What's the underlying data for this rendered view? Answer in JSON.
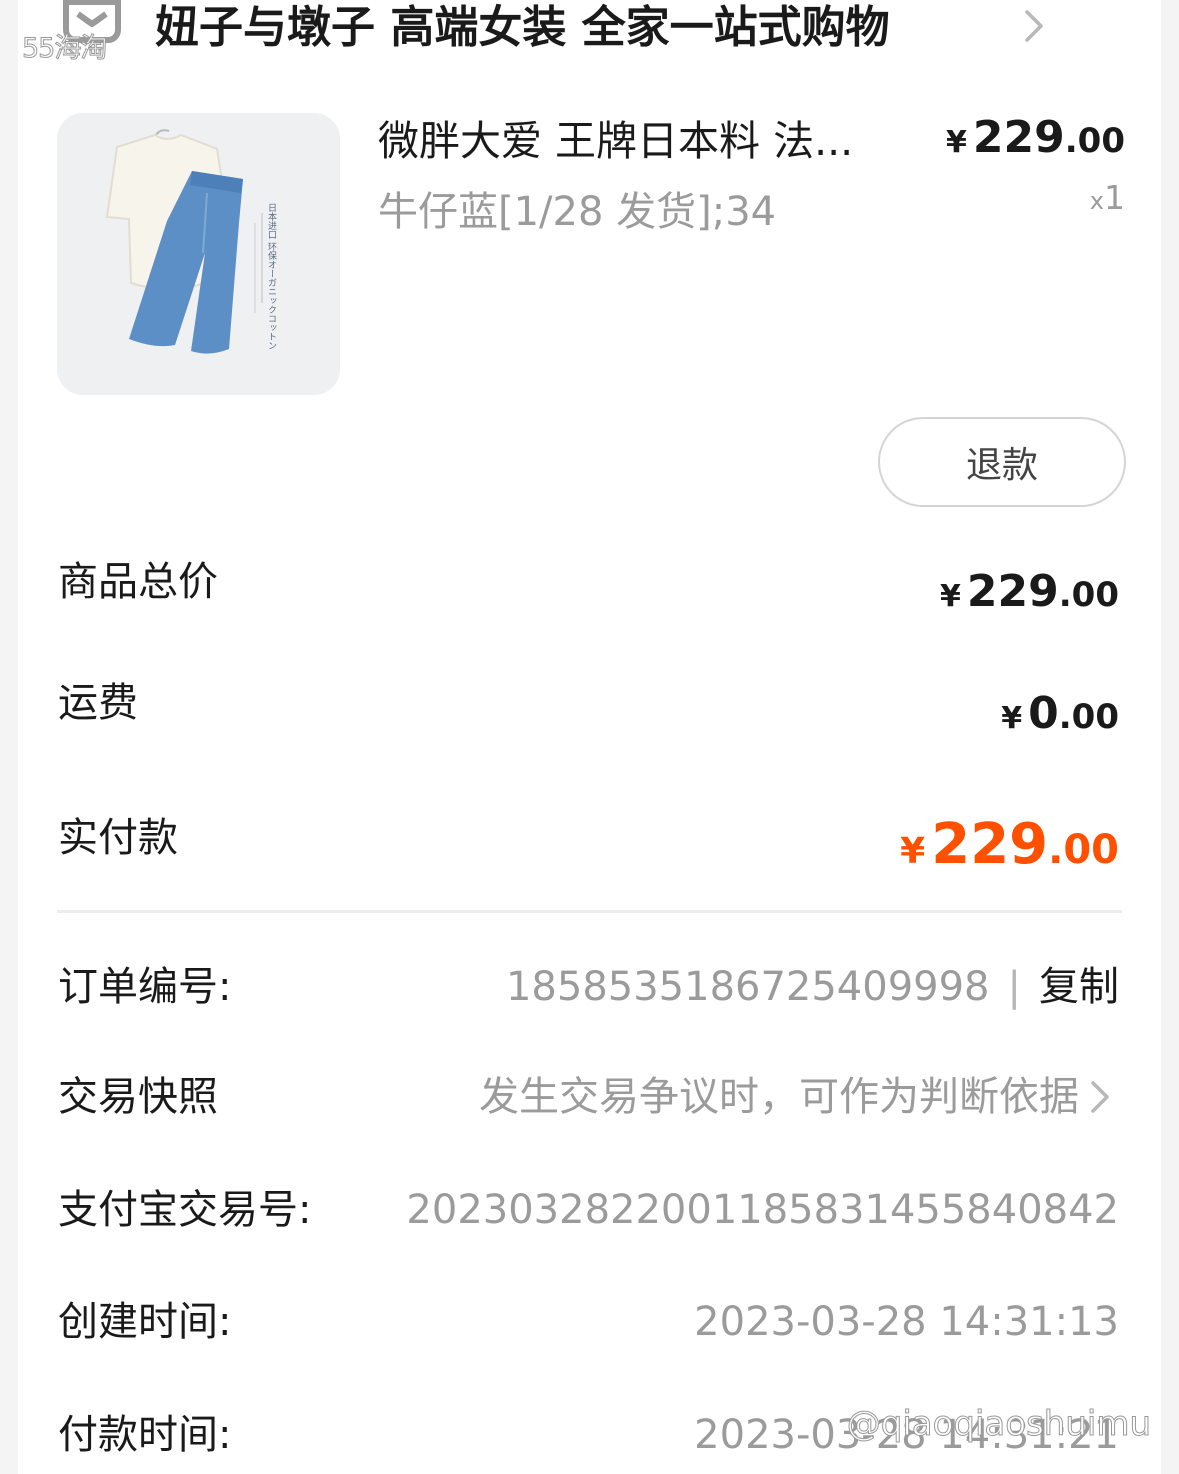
{
  "header": {
    "shop_name": "妞子与墩子 高端女装 全家一站式购物",
    "watermark": "55海淘"
  },
  "product": {
    "title": "微胖大爱 王牌日本料 法...",
    "spec": "牛仔蓝[1/28 发货];34",
    "price_symbol": "¥",
    "price_int": "229",
    "price_dec": ".00",
    "qty_prefix": "x",
    "qty": "1",
    "thumb_text": "日本进口 环保オーガニックコットン",
    "refund_label": "退款"
  },
  "summary": {
    "goods_total_label": "商品总价",
    "goods_total_symbol": "¥",
    "goods_total_int": "229",
    "goods_total_dec": ".00",
    "shipping_label": "运费",
    "shipping_symbol": "¥",
    "shipping_int": "0",
    "shipping_dec": ".00",
    "paid_label": "实付款",
    "paid_symbol": "¥",
    "paid_int": "229",
    "paid_dec": ".00"
  },
  "details": {
    "order_no_label": "订单编号:",
    "order_no": "1858535186725409998",
    "copy_sep": "|",
    "copy_label": "复制",
    "snapshot_label": "交易快照",
    "snapshot_value": "发生交易争议时，可作为判断依据",
    "alipay_label": "支付宝交易号:",
    "alipay_no": "2023032822001185831455840842",
    "created_label": "创建时间:",
    "created_time": "2023-03-28 14:31:13",
    "paid_time_label": "付款时间:",
    "paid_time": "2023-03-28 14:31:21"
  },
  "watermark_handle": "@qiaoqiaoshuimu",
  "colors": {
    "accent": "#ff5000",
    "muted_text": "#9b9b9b",
    "text": "#1a1a1a",
    "background": "#f4f4f4"
  },
  "icons": [
    "shop-icon",
    "chevron-right-icon"
  ]
}
